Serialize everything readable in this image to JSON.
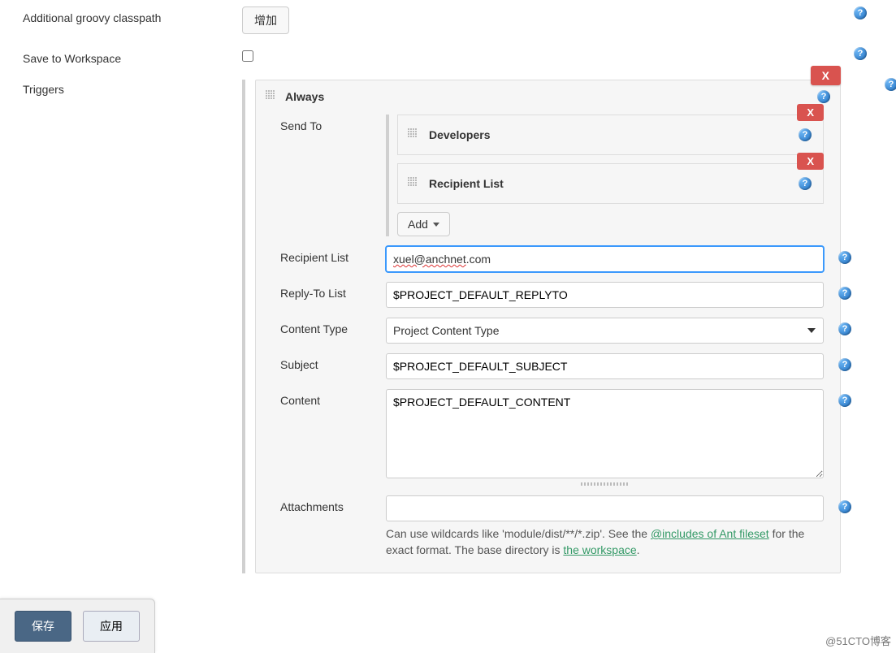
{
  "settings": {
    "classpath_label": "Additional groovy classpath",
    "classpath_button": "增加",
    "save_workspace_label": "Save to Workspace",
    "triggers_label": "Triggers"
  },
  "trigger": {
    "name": "Always",
    "remove": "X",
    "sendto_label": "Send To",
    "recipients": [
      {
        "title": "Developers",
        "remove": "X"
      },
      {
        "title": "Recipient List",
        "remove": "X"
      }
    ],
    "add_label": "Add",
    "fields": {
      "recipient_list_label": "Recipient List",
      "recipient_list_value": "xuel@anchnet.com",
      "recipient_wavy": "xuel@anchnet",
      "recipient_rest": ".com",
      "replyto_label": "Reply-To List",
      "replyto_value": "$PROJECT_DEFAULT_REPLYTO",
      "contenttype_label": "Content Type",
      "contenttype_value": "Project Content Type",
      "subject_label": "Subject",
      "subject_value": "$PROJECT_DEFAULT_SUBJECT",
      "content_label": "Content",
      "content_value": "$PROJECT_DEFAULT_CONTENT",
      "attachments_label": "Attachments",
      "attachments_value": "",
      "attachments_hint_pre": "Can use wildcards like 'module/dist/**/*.zip'. See the ",
      "attachments_link1": "@includes of Ant fileset",
      "attachments_hint_mid": " for the exact format. The base directory is ",
      "attachments_link2": "the workspace",
      "attachments_hint_post": "."
    }
  },
  "footer": {
    "save": "保存",
    "apply": "应用"
  },
  "watermark": "@51CTO博客",
  "helpglyph": "?"
}
